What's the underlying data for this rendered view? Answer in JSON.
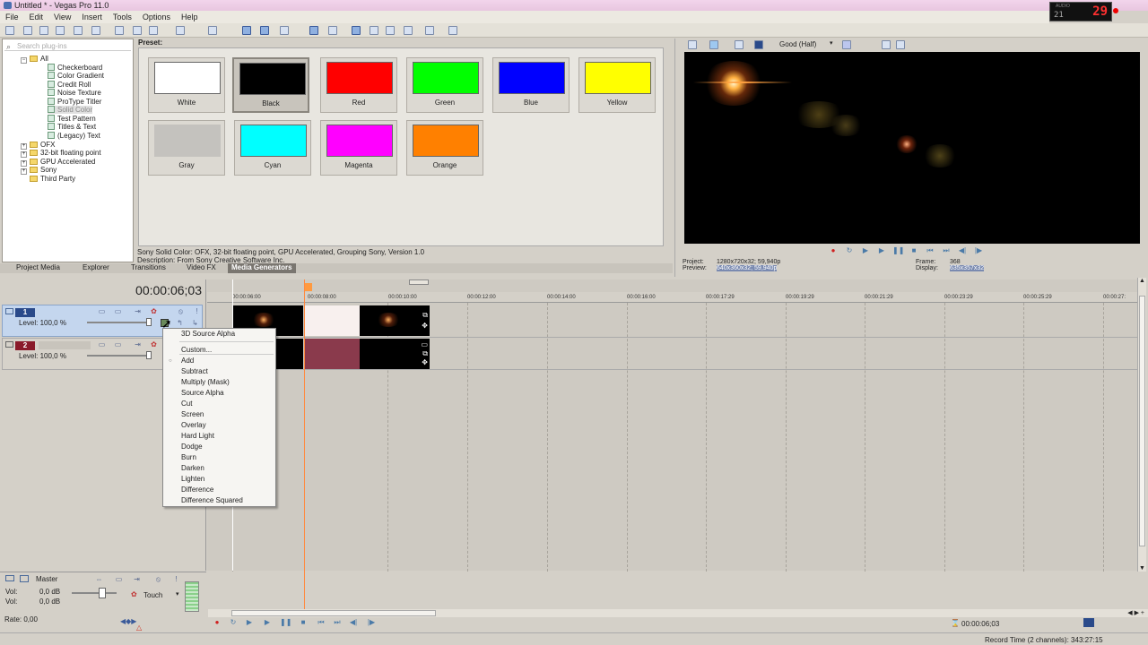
{
  "window": {
    "title": "Untitled * - Vegas Pro 11.0",
    "clock_small": "21",
    "clock_big": "29",
    "clock_label": "AUDIO"
  },
  "menu": [
    "File",
    "Edit",
    "View",
    "Insert",
    "Tools",
    "Options",
    "Help"
  ],
  "plugins": {
    "search_placeholder": "Search plug-ins",
    "tree": [
      {
        "label": "All",
        "kind": "folder",
        "level": 0
      },
      {
        "label": "Checkerboard",
        "kind": "fx",
        "level": 1
      },
      {
        "label": "Color Gradient",
        "kind": "fx",
        "level": 1
      },
      {
        "label": "Credit Roll",
        "kind": "fx",
        "level": 1
      },
      {
        "label": "Noise Texture",
        "kind": "fx",
        "level": 1
      },
      {
        "label": "ProType Titler",
        "kind": "fx",
        "level": 1
      },
      {
        "label": "Solid Color",
        "kind": "fx",
        "level": 1,
        "selected": true
      },
      {
        "label": "Test Pattern",
        "kind": "fx",
        "level": 1
      },
      {
        "label": "Titles & Text",
        "kind": "fx",
        "level": 1
      },
      {
        "label": "(Legacy) Text",
        "kind": "fx",
        "level": 1
      },
      {
        "label": "OFX",
        "kind": "folder",
        "level": 0
      },
      {
        "label": "32-bit floating point",
        "kind": "folder",
        "level": 0
      },
      {
        "label": "GPU Accelerated",
        "kind": "folder",
        "level": 0
      },
      {
        "label": "Sony",
        "kind": "folder",
        "level": 0
      },
      {
        "label": "Third Party",
        "kind": "folder",
        "level": 0
      }
    ]
  },
  "presets": {
    "label": "Preset:",
    "items": [
      {
        "label": "White",
        "color": "#ffffff"
      },
      {
        "label": "Black",
        "color": "#000000",
        "selected": true
      },
      {
        "label": "Red",
        "color": "#ff0000"
      },
      {
        "label": "Green",
        "color": "#00ff00"
      },
      {
        "label": "Blue",
        "color": "#0000ff"
      },
      {
        "label": "Yellow",
        "color": "#ffff00"
      },
      {
        "label": "Gray",
        "color": "#c4c2be"
      },
      {
        "label": "Cyan",
        "color": "#00ffff"
      },
      {
        "label": "Magenta",
        "color": "#ff00ff"
      },
      {
        "label": "Orange",
        "color": "#ff8000"
      }
    ],
    "info_line1": "Sony Solid Color: OFX, 32-bit floating point, GPU Accelerated, Grouping Sony, Version 1.0",
    "info_line2": "Description: From Sony Creative Software Inc."
  },
  "tabs": [
    {
      "label": "Project Media"
    },
    {
      "label": "Explorer"
    },
    {
      "label": "Transitions"
    },
    {
      "label": "Video FX"
    },
    {
      "label": "Media Generators",
      "active": true
    }
  ],
  "preview": {
    "quality": "Good (Half)",
    "project_label": "Project:",
    "project_value": "1280x720x32; 59,940p",
    "preview_label": "Preview:",
    "preview_value": "640x360x32; 59,940p",
    "frame_label": "Frame:",
    "frame_value": "368",
    "display_label": "Display:",
    "display_value": "635x357x32"
  },
  "timeline": {
    "timecode": "00:00:06;03",
    "ruler": [
      "00:00:06:00",
      "00:00:08:00",
      "00:00:10:00",
      "00:00:12:00",
      "00:00:14:00",
      "00:00:16:00",
      "00:00:17:29",
      "00:00:19:29",
      "00:00:21:29",
      "00:00:23:29",
      "00:00:25:29",
      "00:00:27:"
    ],
    "tracks": [
      {
        "num": "1",
        "level": "Level: 100,0 %",
        "color": "#2a4a8a"
      },
      {
        "num": "2",
        "level": "Level: 100,0 %",
        "color": "#8a1a2a"
      }
    ]
  },
  "context_menu": {
    "items": [
      {
        "label": "3D Source Alpha",
        "checked": false
      },
      {
        "label": "Custom...",
        "checked": false
      },
      {
        "label": "Add",
        "checked": true
      },
      {
        "label": "Subtract",
        "checked": false
      },
      {
        "label": "Multiply (Mask)",
        "checked": false
      },
      {
        "label": "Source Alpha",
        "checked": false
      },
      {
        "label": "Cut",
        "checked": false
      },
      {
        "label": "Screen",
        "checked": false
      },
      {
        "label": "Overlay",
        "checked": false
      },
      {
        "label": "Hard Light",
        "checked": false
      },
      {
        "label": "Dodge",
        "checked": false
      },
      {
        "label": "Burn",
        "checked": false
      },
      {
        "label": "Darken",
        "checked": false
      },
      {
        "label": "Lighten",
        "checked": false
      },
      {
        "label": "Difference",
        "checked": false
      },
      {
        "label": "Difference Squared",
        "checked": false
      }
    ]
  },
  "master": {
    "label": "Master",
    "vol1_label": "Vol:",
    "vol1_value": "0,0 dB",
    "vol2_label": "Vol:",
    "vol2_value": "0,0 dB",
    "touch": "Touch"
  },
  "status": {
    "rate": "Rate: 0,00",
    "timecode": "00:00:06;03",
    "record_time": "Record Time (2 channels): 343:27:15"
  }
}
